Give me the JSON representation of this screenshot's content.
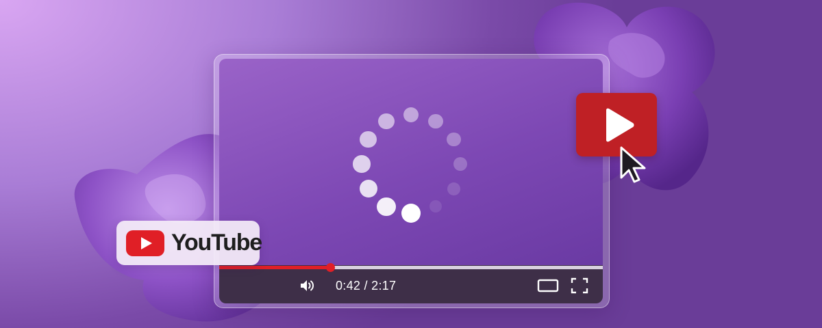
{
  "player": {
    "time_label": "0:42 / 2:17",
    "progress_fraction": 0.29,
    "loading": true
  },
  "brand_badge": {
    "wordmark": "YouTube",
    "logo_icon": "youtube-logo-icon"
  },
  "icons": {
    "volume": "volume-icon",
    "theater_mode": "theater-mode-icon",
    "fullscreen": "fullscreen-icon",
    "play": "play-icon",
    "cursor": "cursor-arrow-icon",
    "spinner": "loading-spinner-icon"
  },
  "colors": {
    "accent_red": "#e01f26",
    "play_button_red": "#bf2025",
    "control_bar": "#3e2f48",
    "background_purple": "#a97dd6"
  }
}
